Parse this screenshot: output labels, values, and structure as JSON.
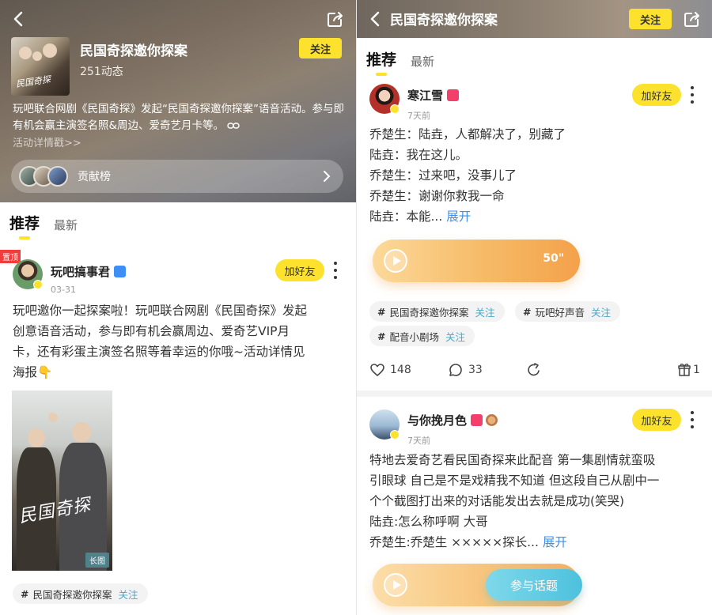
{
  "topic": {
    "title": "民国奇探邀你探案",
    "count": "251动态",
    "follow_label": "关注",
    "description": "玩吧联合网剧《民国奇探》发起“民国奇探邀你探案”语音活动。参与即有机会赢主演签名照&周边、爱奇艺月卡等。",
    "more_link": "活动详情戳>>",
    "contributors_label": "贡献榜",
    "cover_text": "民国奇探"
  },
  "tabs": {
    "recommend": "推荐",
    "latest": "最新"
  },
  "left_post": {
    "pin_label": "置顶",
    "user": "玩吧搞事君",
    "time": "03-31",
    "add_friend": "加好友",
    "lines": [
      "玩吧邀你一起探案啦！玩吧联合网剧《民国奇探》发起",
      "创意语音活动，参与即有机会赢周边、爱奇艺VIP月",
      "卡，还有彩蛋主演签名照等着幸运的你哦~活动详情见",
      "海报👇"
    ],
    "poster_title": "民国奇探",
    "long_image_label": "长图",
    "tags": [
      {
        "name": "民国奇探邀你探案",
        "follow": "关注"
      }
    ]
  },
  "right_header": {
    "title": "民国奇探邀你探案",
    "follow_label": "关注"
  },
  "right_post1": {
    "user": "寒江雪",
    "time": "7天前",
    "add_friend": "加好友",
    "lines": [
      "乔楚生：陆垚，人都解决了，别藏了",
      "陆垚：我在这儿。",
      "乔楚生：过来吧，没事儿了",
      "乔楚生：谢谢你救我一命"
    ],
    "last_line": "陆垚：本能...",
    "expand": "展开",
    "audio_duration": "50\"",
    "tags": [
      {
        "name": "民国奇探邀你探案",
        "follow": "关注"
      },
      {
        "name": "玩吧好声音",
        "follow": "关注"
      },
      {
        "name": "配音小剧场",
        "follow": "关注"
      }
    ],
    "likes": "148",
    "comments": "33",
    "gifts": "1"
  },
  "right_post2": {
    "user": "与你挽月色",
    "time": "7天前",
    "add_friend": "加好友",
    "lines": [
      "特地去爱奇艺看民国奇探来此配音 第一集剧情就蛮吸",
      "引眼球 自己是不是戏精我不知道 但这段自己从剧中一",
      "个个截图打出来的对话能发出去就是成功(笑哭)",
      "陆垚:怎么称呼啊 大哥"
    ],
    "last_line": "乔楚生:乔楚生 ×××××探长...",
    "expand": "展开",
    "join_label": "参与话题"
  },
  "colors": {
    "accent_yellow": "#fce22d",
    "expand_blue": "#3f8fe8",
    "tag_follow": "#4aa8c8",
    "pin_red": "#f13c3c",
    "audio_orange": "#f4a14a",
    "join_cyan": "#4cc1dd"
  },
  "icons": [
    "back-icon",
    "share-icon",
    "link-icon",
    "chevron-right-icon",
    "more-icon",
    "play-icon",
    "heart-icon",
    "comment-icon",
    "share-arrow-icon",
    "gift-icon"
  ]
}
